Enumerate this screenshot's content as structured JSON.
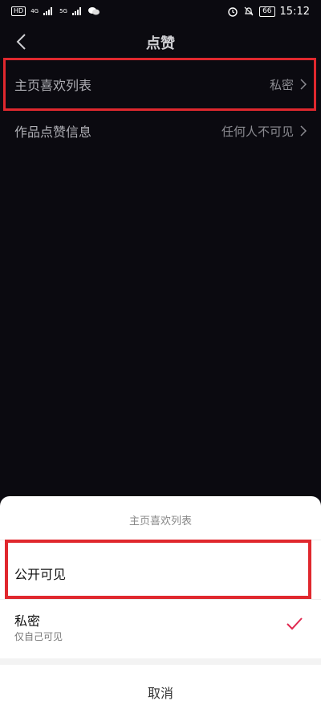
{
  "status_bar": {
    "hd_badge": "HD",
    "net_4g": "4G",
    "net_5g": "5G",
    "battery": "66",
    "time": "15:12"
  },
  "header": {
    "title": "点赞"
  },
  "settings": [
    {
      "label": "主页喜欢列表",
      "value": "私密"
    },
    {
      "label": "作品点赞信息",
      "value": "任何人不可见"
    }
  ],
  "sheet": {
    "title": "主页喜欢列表",
    "option_public": "公开可见",
    "option_private_title": "私密",
    "option_private_sub": "仅自己可见",
    "cancel": "取消"
  },
  "colors": {
    "background": "#0b0a10",
    "highlight": "#e0282e",
    "check": "#e0284f"
  }
}
